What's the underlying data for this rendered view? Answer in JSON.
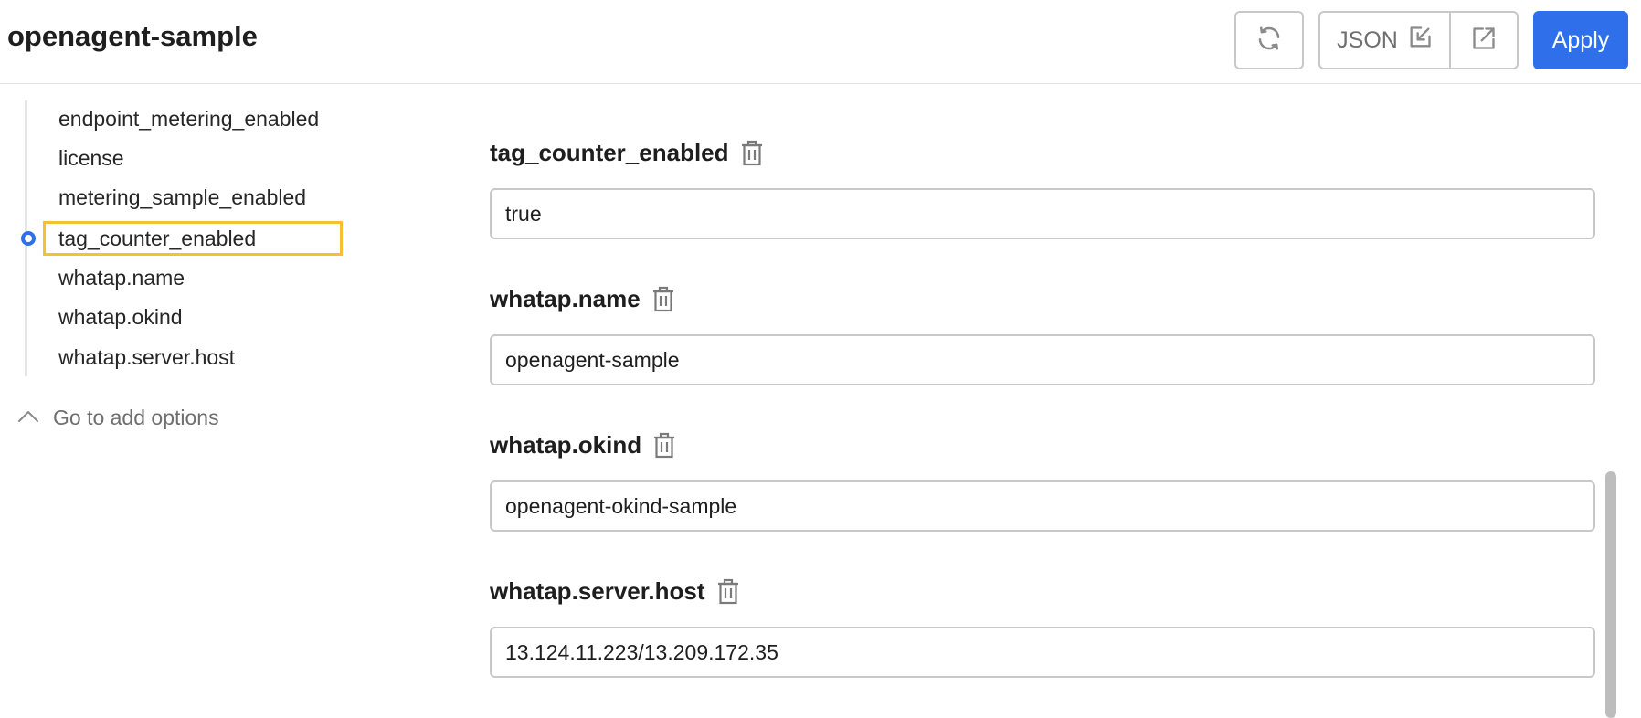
{
  "header": {
    "title": "openagent-sample",
    "refresh_icon": "refresh-icon",
    "json_label": "JSON",
    "json_icon": "edit-import-icon",
    "open_icon": "external-link-icon",
    "apply_label": "Apply"
  },
  "sidebar": {
    "items": [
      {
        "label": "endpoint_metering_enabled",
        "active": false
      },
      {
        "label": "license",
        "active": false
      },
      {
        "label": "metering_sample_enabled",
        "active": false
      },
      {
        "label": "tag_counter_enabled",
        "active": true
      },
      {
        "label": "whatap.name",
        "active": false
      },
      {
        "label": "whatap.okind",
        "active": false
      },
      {
        "label": "whatap.server.host",
        "active": false
      }
    ],
    "goto_label": "Go to add options",
    "goto_icon": "chevron-up-icon"
  },
  "fields": [
    {
      "label": "tag_counter_enabled",
      "value": "true",
      "icon": "trash-icon"
    },
    {
      "label": "whatap.name",
      "value": "openagent-sample",
      "icon": "trash-icon"
    },
    {
      "label": "whatap.okind",
      "value": "openagent-okind-sample",
      "icon": "trash-icon"
    },
    {
      "label": "whatap.server.host",
      "value": "13.124.11.223/13.209.172.35",
      "icon": "trash-icon"
    }
  ],
  "colors": {
    "accent": "#2f6fea",
    "highlight": "#f5c033",
    "border": "#c8c8c8"
  }
}
